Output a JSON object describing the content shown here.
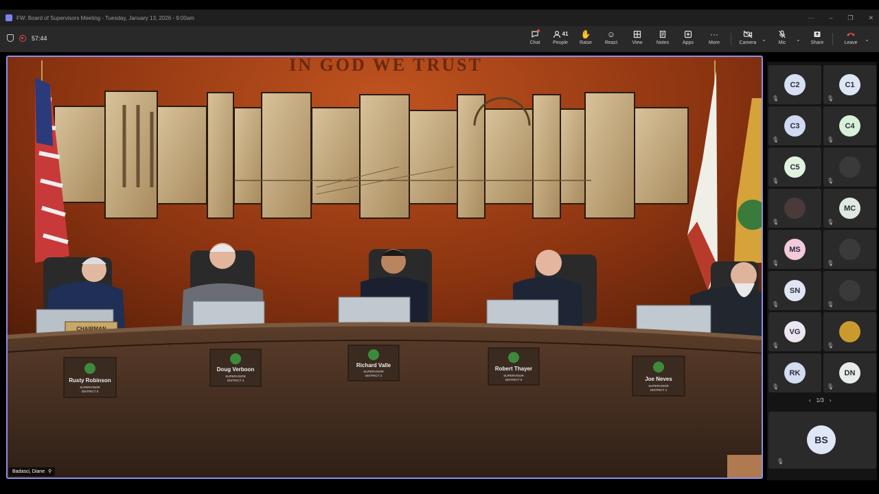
{
  "window": {
    "title": "FW: Board of Supervisors Meeting - Tuesday, January 13, 2026 - 9:00am",
    "controls": [
      "···",
      "–",
      "❐",
      "✕"
    ]
  },
  "recording": {
    "elapsed": "57:44"
  },
  "toolbar": {
    "chat": "Chat",
    "people": "People",
    "people_count": "41",
    "raise": "Raise",
    "react": "React",
    "view": "View",
    "notes": "Notes",
    "apps": "Apps",
    "more": "More",
    "camera": "Camera",
    "mic": "Mic",
    "share": "Share",
    "leave": "Leave"
  },
  "video": {
    "speaker_name": "Badasci, Diane",
    "wall_motto": "IN GOD WE TRUST",
    "chair_plaque": "CHAIRMAN",
    "supervisors": [
      {
        "name": "Rusty Robinson",
        "title": "SUPERVISOR",
        "district": "DISTRICT 6"
      },
      {
        "name": "Doug Verboon",
        "title": "SUPERVISOR",
        "district": "DISTRICT 3"
      },
      {
        "name": "Richard Valle",
        "title": "SUPERVISOR",
        "district": "DISTRICT 2"
      },
      {
        "name": "Robert Thayer",
        "title": "SUPERVISOR",
        "district": "DISTRICT 5"
      },
      {
        "name": "Joe Neves",
        "title": "SUPERVISOR",
        "district": "DISTRICT 1"
      }
    ]
  },
  "participants": [
    {
      "initials": "C2",
      "color": "#d7e0f3"
    },
    {
      "initials": "C1",
      "color": "#dde6f2"
    },
    {
      "initials": "C3",
      "color": "#cfdaf2"
    },
    {
      "initials": "C4",
      "color": "#d8efd9"
    },
    {
      "initials": "C5",
      "color": "#dff3e0"
    },
    {
      "initials": "",
      "color": "#3a3a3a"
    },
    {
      "initials": "",
      "color": "#4a3a3a"
    },
    {
      "initials": "MC",
      "color": "#dfe9df"
    },
    {
      "initials": "MS",
      "color": "#f3c9dc"
    },
    {
      "initials": "",
      "color": "#3a3a3a"
    },
    {
      "initials": "SN",
      "color": "#dfe5f3"
    },
    {
      "initials": "",
      "color": "#3a3a3a"
    },
    {
      "initials": "VG",
      "color": "#ece6f3"
    },
    {
      "initials": "",
      "color": "#c99a2e"
    },
    {
      "initials": "RK",
      "color": "#d3ddef"
    },
    {
      "initials": "DN",
      "color": "#e8ece8"
    }
  ],
  "pager": {
    "label": "1/3",
    "prev": "‹",
    "next": "›"
  },
  "pinned": {
    "initials": "BS"
  },
  "icons": {
    "chat": "chat-icon",
    "people": "people-icon",
    "raise": "hand-icon",
    "react": "smile-icon",
    "view": "grid-icon",
    "notes": "notes-icon",
    "apps": "plus-icon",
    "more": "ellipsis-icon",
    "camera": "camera-off-icon",
    "mic": "mic-off-icon",
    "share": "share-icon",
    "leave": "phone-icon"
  }
}
